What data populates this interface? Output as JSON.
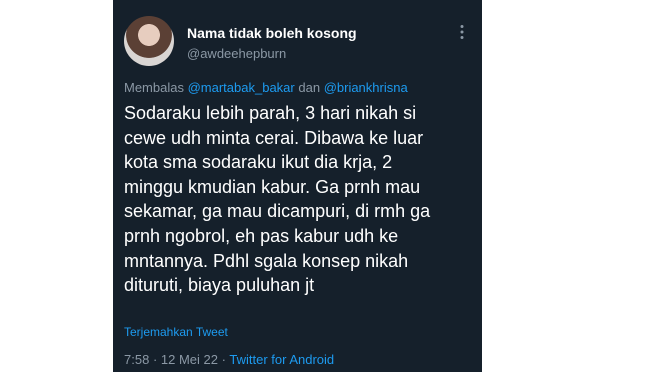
{
  "tweet": {
    "display_name": "Nama tidak boleh kosong",
    "handle": "@awdeehepburn",
    "reply_prefix": "Membalas",
    "mention1": "@martabak_bakar",
    "reply_joiner": "dan",
    "mention2": "@briankhrisna",
    "body_lines": [
      "Sodaraku lebih parah, 3 hari nikah si",
      "cewe udh minta cerai. Dibawa ke luar",
      "kota sma sodaraku ikut dia krja, 2",
      "minggu kmudian kabur. Ga prnh mau",
      "sekamar, ga mau dicampuri, di rmh ga",
      "prnh ngobrol, eh pas kabur udh ke",
      "mntannya. Pdhl sgala konsep nikah",
      "dituruti, biaya puluhan jt"
    ],
    "translate_label": "Terjemahkan Tweet",
    "time": "7:58",
    "separator": "·",
    "date": "12 Mei 22",
    "source": "Twitter for Android"
  },
  "colors": {
    "card_background": "#15202b",
    "link_blue": "#1d9bf0",
    "muted_gray": "#8b98a5",
    "text_white": "#ffffff"
  },
  "icons": {
    "more_options": "more-vertical-icon"
  }
}
